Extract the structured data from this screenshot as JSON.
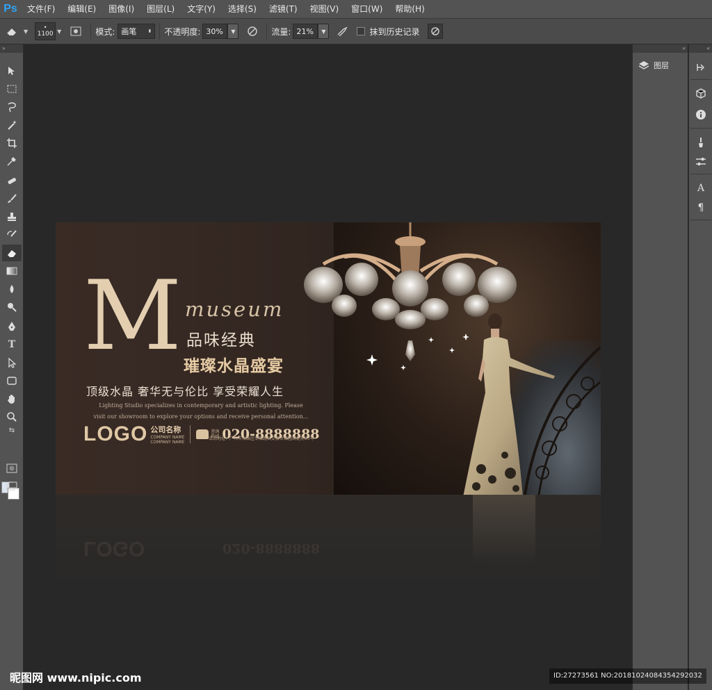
{
  "app": {
    "logo": "Ps"
  },
  "menu": [
    "文件(F)",
    "编辑(E)",
    "图像(I)",
    "图层(L)",
    "文字(Y)",
    "选择(S)",
    "滤镜(T)",
    "视图(V)",
    "窗口(W)",
    "帮助(H)"
  ],
  "options": {
    "brush_size": "1100",
    "mode_label": "模式:",
    "mode_value": "画笔",
    "opacity_label": "不透明度:",
    "opacity_value": "30%",
    "flow_label": "流量:",
    "flow_value": "21%",
    "erase_history_label": "抹到历史记录"
  },
  "tools": [
    "move-tool",
    "marquee-tool",
    "lasso-tool",
    "magic-wand-tool",
    "crop-tool",
    "eyedropper-tool",
    "healing-brush-tool",
    "brush-tool",
    "clone-stamp-tool",
    "history-brush-tool",
    "eraser-tool",
    "gradient-tool",
    "blur-tool",
    "dodge-tool",
    "pen-tool",
    "type-tool",
    "path-selection-tool",
    "shape-tool",
    "hand-tool",
    "zoom-tool"
  ],
  "panels": {
    "layers_label": "图层"
  },
  "poster": {
    "big_letter": "M",
    "museum": "museum",
    "line1": "品味经典",
    "line2": "璀璨水晶盛宴",
    "slogan": "顶级水晶  奢华无与伦比  享受荣耀人生",
    "desc1": "Lighting Studio specializes in contemporary and artistic lighting. Please",
    "desc2": "visit our showroom to explore your options and receive personal attention...",
    "logo": "LOGO",
    "company_cn": "公司名称",
    "company_en1": "COMPANY NAME",
    "company_en2": "COMPANY NAME",
    "hotline1": "咨询",
    "hotline2": "热线",
    "phone": "020-8888888",
    "address": "活动地址：广州市海珠区幸福路口交接幸福园商处前33号"
  },
  "watermark": {
    "left": "昵图网 www.nipic.com",
    "right": "ID:27273561 NO:20181024084354292032"
  },
  "colors": {
    "accent_gold": "#d9c2a0",
    "ps_blue": "#2fa3f7"
  }
}
